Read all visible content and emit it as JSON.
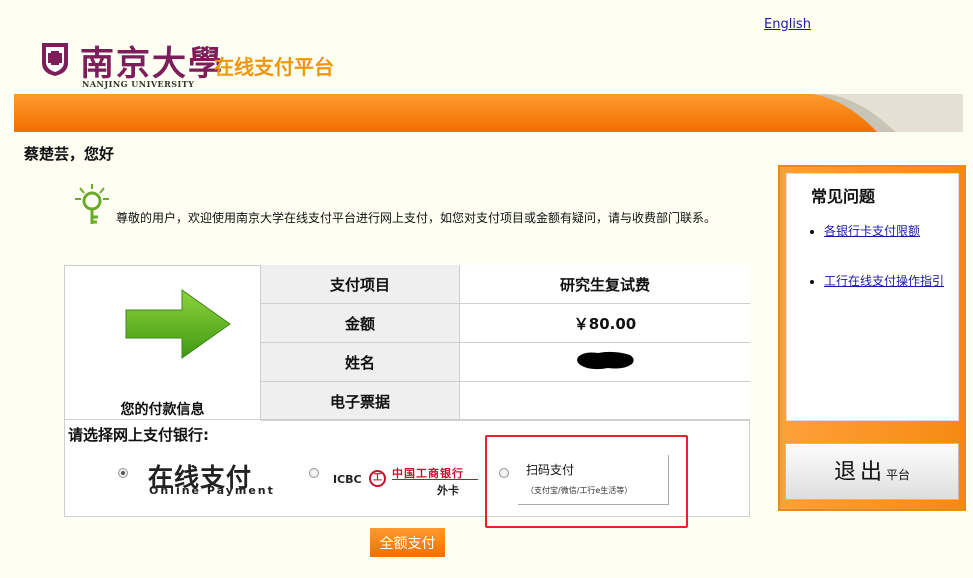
{
  "header": {
    "language_link": "English",
    "logo_cn": "南京大學",
    "logo_en": "NANJING UNIVERSITY",
    "platform_title": "在线支付平台"
  },
  "colors": {
    "accent_orange": "#f26f00",
    "frame_red": "#e8212b",
    "link_blue": "#1a1aa8"
  },
  "greeting": "蔡楚芸，您好",
  "notice": "尊敬的用户，欢迎使用南京大学在线支付平台进行网上支付，如您对支付项目或金额有疑问，请与收费部门联系。",
  "payment_info": {
    "label": "您的付款信息",
    "rows": [
      {
        "key": "支付项目",
        "value": "研究生复试费"
      },
      {
        "key": "金额",
        "value": "￥80.00"
      },
      {
        "key": "姓名",
        "value": ""
      },
      {
        "key": "电子票据",
        "value": ""
      }
    ]
  },
  "bank_select": {
    "label": "请选择网上支付银行:",
    "options": {
      "online_cn": "在线支付",
      "online_en": "Online Payment",
      "icbc_text": "ICBC",
      "icbc_logo": "工",
      "icbc_name": "中国工商银行",
      "icbc_sub": "外卡",
      "scan_title": "扫码支付",
      "scan_sub": "（支付宝/微信/工行e生活等）"
    }
  },
  "pay_button": "全额支付",
  "faq": {
    "title": "常见问题",
    "links": [
      "各银行卡支付限额",
      "工行在线支付操作指引"
    ]
  },
  "logout": {
    "main": "退出",
    "sub": "平台"
  },
  "icons": [
    "university-seal-icon",
    "notice-icon",
    "arrow-right-icon",
    "icbc-logo-icon",
    "redacted-name-blot"
  ]
}
